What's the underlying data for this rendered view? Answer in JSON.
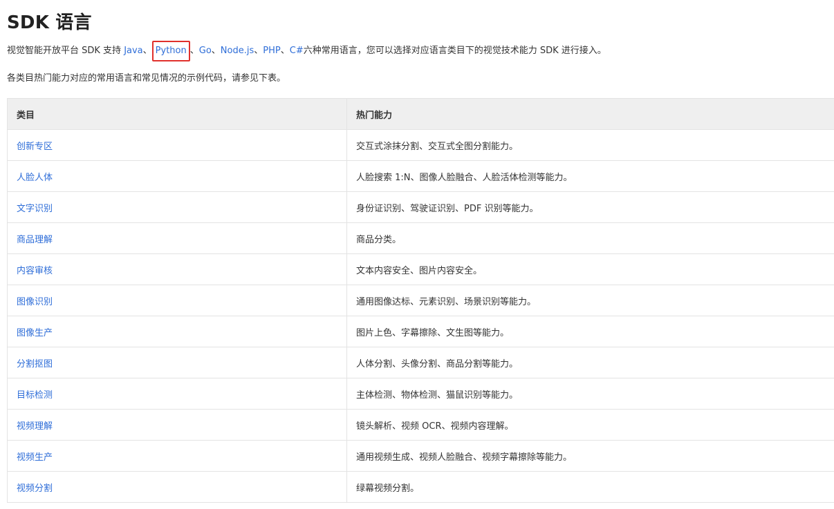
{
  "page": {
    "title": "SDK 语言",
    "intro": {
      "prefix": "视觉智能开放平台 SDK 支持 ",
      "languages": [
        "Java",
        "Python",
        "Go",
        "Node.js",
        "PHP",
        "C#"
      ],
      "separator": "、",
      "suffix": "六种常用语言，您可以选择对应语言类目下的视觉技术能力 SDK 进行接入。"
    },
    "note": "各类目热门能力对应的常用语言和常见情况的示例代码，请参见下表。"
  },
  "table": {
    "headers": [
      "类目",
      "热门能力"
    ],
    "rows": [
      {
        "category": "创新专区",
        "abilities": "交互式涂抹分割、交互式全图分割能力。"
      },
      {
        "category": "人脸人体",
        "abilities": "人脸搜索 1:N、图像人脸融合、人脸活体检测等能力。"
      },
      {
        "category": "文字识别",
        "abilities": "身份证识别、驾驶证识别、PDF 识别等能力。"
      },
      {
        "category": "商品理解",
        "abilities": "商品分类。"
      },
      {
        "category": "内容审核",
        "abilities": "文本内容安全、图片内容安全。"
      },
      {
        "category": "图像识别",
        "abilities": "通用图像达标、元素识别、场景识别等能力。"
      },
      {
        "category": "图像生产",
        "abilities": "图片上色、字幕擦除、文生图等能力。"
      },
      {
        "category": "分割抠图",
        "abilities": "人体分割、头像分割、商品分割等能力。"
      },
      {
        "category": "目标检测",
        "abilities": "主体检测、物体检测、猫鼠识别等能力。"
      },
      {
        "category": "视频理解",
        "abilities": "镜头解析、视频 OCR、视频内容理解。"
      },
      {
        "category": "视频生产",
        "abilities": "通用视频生成、视频人脸融合、视频字幕擦除等能力。"
      },
      {
        "category": "视频分割",
        "abilities": "绿幕视频分割。"
      }
    ]
  },
  "colors": {
    "link": "#2f6ed8",
    "highlight_box": "#e0302b",
    "header_bg": "#efefef",
    "border": "#e3e3e3"
  }
}
